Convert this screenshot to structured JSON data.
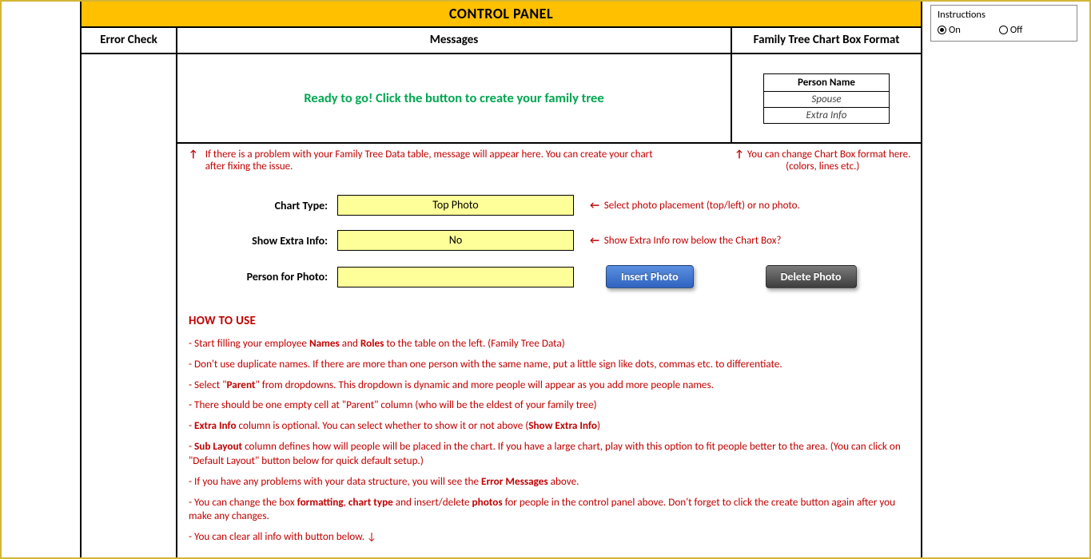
{
  "title": "CONTROL PANEL",
  "headers": {
    "error": "Error Check",
    "messages": "Messages",
    "format": "Family Tree Chart Box Format"
  },
  "message": "Ready to go! Click the button to create your family tree",
  "format_box": {
    "name": "Person Name",
    "spouse": "Spouse",
    "extra": "Extra Info"
  },
  "hints": {
    "message_arrow": "↑",
    "message_text": "If there is a problem with your Family Tree Data table, message will appear here. You can create your chart after fixing the issue.",
    "format_arrow": "↑",
    "format_text": "You can change Chart Box format here. (colors, lines etc.)"
  },
  "controls": {
    "chart_type": {
      "label": "Chart Type:",
      "value": "Top Photo",
      "hint_arrow": "←",
      "hint": "Select photo placement (top/left) or no photo."
    },
    "show_extra": {
      "label": "Show Extra Info:",
      "value": "No",
      "hint_arrow": "←",
      "hint": "Show Extra Info row below the Chart Box?"
    },
    "person_photo": {
      "label": "Person for Photo:",
      "value": ""
    }
  },
  "buttons": {
    "insert": "Insert Photo",
    "delete": "Delete Photo"
  },
  "howto": {
    "title": "HOW TO USE",
    "l1a": "- Start filling your employee ",
    "l1b": "Names",
    "l1c": " and ",
    "l1d": "Roles",
    "l1e": " to the table on the left. (Family Tree Data)",
    "l2": "- Don't use duplicate names. If there are more than one person with the same name, put a little sign like dots, commas etc. to differentiate.",
    "l3a": "- Select \"",
    "l3b": "Parent",
    "l3c": "\" from dropdowns. This dropdown is dynamic and more people will appear as you add more people names.",
    "l4": "- There should be one empty cell at \"Parent\" column (who will be the eldest of your family tree)",
    "l5a": "- ",
    "l5b": "Extra Info",
    "l5c": " column is optional. You can select whether to show it or not above (",
    "l5d": "Show Extra Info",
    "l5e": ")",
    "l6a": "- ",
    "l6b": "Sub Layout",
    "l6c": " column defines how will people will be placed in the chart. If you have a large chart, play with this option to fit people better to the area. (You can click on \"Default Layout\" button below for quick default setup.)",
    "l7a": "- If you have any problems with your data structure, you will see the ",
    "l7b": "Error Messages",
    "l7c": " above.",
    "l8a": "- You can change the box ",
    "l8b": "formatting",
    "l8c": ", ",
    "l8d": "chart type",
    "l8e": " and insert/delete ",
    "l8f": "photos",
    "l8g": " for people in the control panel above. Don't forget to click the create button again after you make any changes.",
    "l9": "- You can clear all info with button below. ↓"
  },
  "instructions": {
    "title": "Instructions",
    "on": "On",
    "off": "Off",
    "selected": "on"
  }
}
